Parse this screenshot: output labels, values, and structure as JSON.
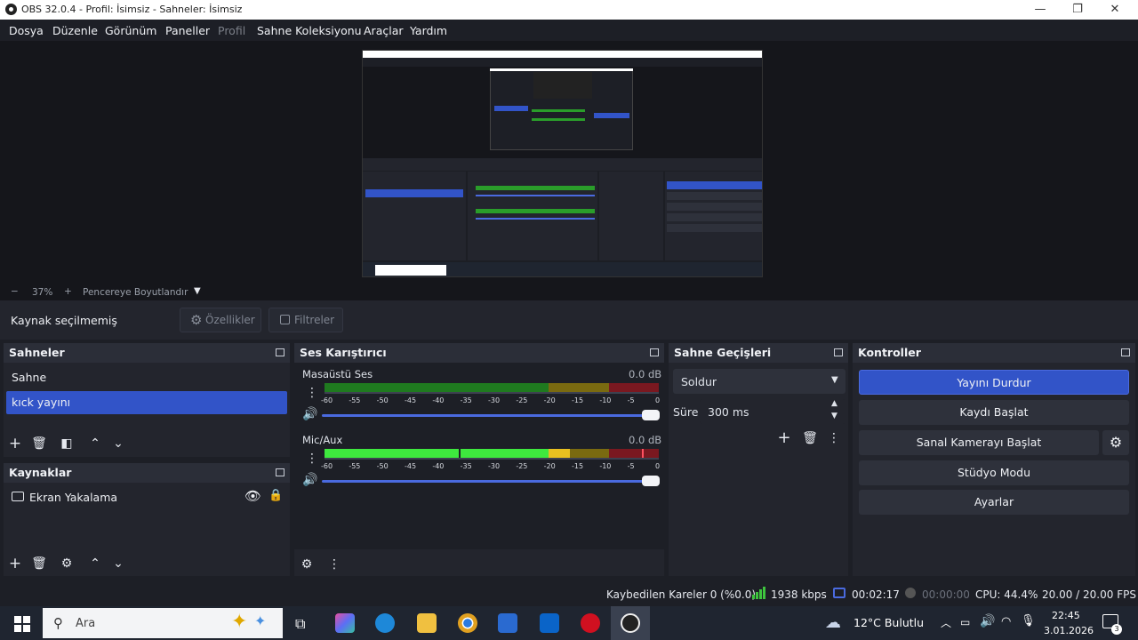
{
  "window": {
    "title": "OBS 32.0.4 - Profil: İsimsiz - Sahneler: İsimsiz",
    "minimize": "—",
    "restore": "❐",
    "close": "✕"
  },
  "menu": [
    "Dosya",
    "Düzenle",
    "Görünüm",
    "Paneller",
    "Profil",
    "Sahne Koleksiyonu",
    "Araçlar",
    "Yardım"
  ],
  "zoom": {
    "minus": "−",
    "value": "37%",
    "plus": "+",
    "mode": "Pencereye Boyutlandır"
  },
  "source_toolbar": {
    "status": "Kaynak seçilmemiş",
    "properties": "Özellikler",
    "filters": "Filtreler"
  },
  "scenes": {
    "title": "Sahneler",
    "items": [
      {
        "label": "Sahne",
        "selected": false
      },
      {
        "label": "kıck yayını",
        "selected": true
      }
    ]
  },
  "sources": {
    "title": "Kaynaklar",
    "items": [
      {
        "label": "Ekran Yakalama",
        "visible": true,
        "locked": false
      }
    ]
  },
  "mixer": {
    "title": "Ses Karıştırıcı",
    "channels": [
      {
        "name": "Masaüstü Ses",
        "db": "0.0 dB",
        "level": 0.0
      },
      {
        "name": "Mic/Aux",
        "db": "0.0 dB",
        "level": 0.62
      }
    ],
    "scale": [
      "-60",
      "-55",
      "-50",
      "-45",
      "-40",
      "-35",
      "-30",
      "-25",
      "-20",
      "-15",
      "-10",
      "-5",
      "0"
    ]
  },
  "transitions": {
    "title": "Sahne Geçişleri",
    "type": "Soldur",
    "duration_label": "Süre",
    "duration": "300 ms"
  },
  "controls": {
    "title": "Kontroller",
    "buttons": [
      "Yayını Durdur",
      "Kaydı Başlat",
      "Sanal Kamerayı Başlat",
      "Stüdyo Modu",
      "Ayarlar"
    ],
    "active_color": "#3254c8"
  },
  "status": {
    "dropped": "Kaybedilen Kareler 0 (%0.0)",
    "bitrate": "1938 kbps",
    "stream_time": "00:02:17",
    "rec_time": "00:00:00",
    "cpu": "CPU: 44.4%",
    "fps": "20.00 / 20.00 FPS"
  },
  "taskbar": {
    "search_placeholder": "Ara",
    "weather": "12°C  Bulutlu",
    "time": "22:45",
    "date": "3.01.2026",
    "notifications": "3"
  }
}
